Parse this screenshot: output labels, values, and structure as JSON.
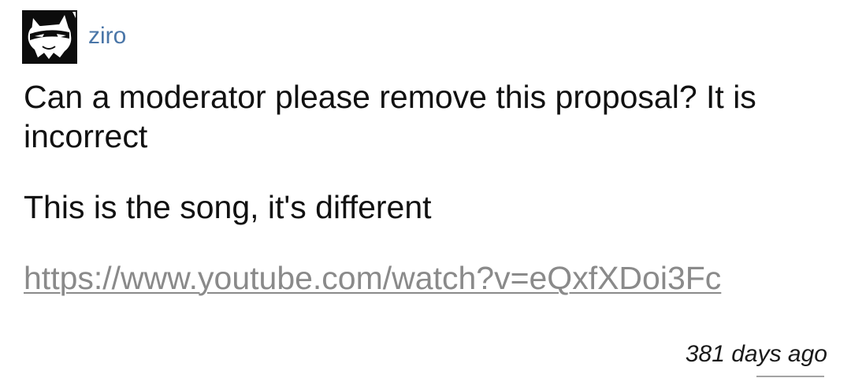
{
  "comment": {
    "author": {
      "username": "ziro",
      "avatar_icon": "wolf-mask-avatar-icon"
    },
    "paragraphs": [
      "Can a moderator please remove this proposal? It is incorrect",
      "This is the song, it's different"
    ],
    "link": {
      "text": "https://www.youtube.com/watch?v=eQxfXDoi3Fc"
    },
    "timestamp": "381 days ago"
  },
  "colors": {
    "username": "#4a76a8",
    "link": "#8a8a8a",
    "text": "#111111",
    "avatar_bg": "#0c0c0c"
  }
}
